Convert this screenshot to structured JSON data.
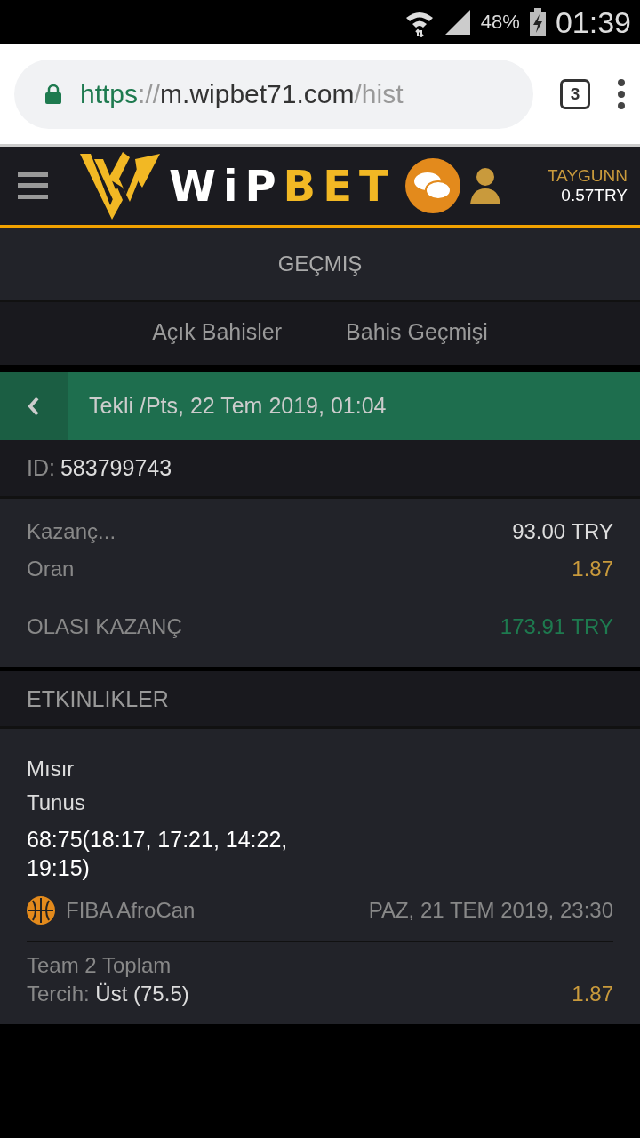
{
  "status_bar": {
    "battery": "48%",
    "time": "01:39"
  },
  "browser": {
    "url": {
      "scheme": "https",
      "sep": "://",
      "host": "m.wipbet71.com",
      "path": "/hist"
    },
    "tab_count": "3"
  },
  "header": {
    "logo": {
      "light": "WiP",
      "accent": "BET"
    },
    "user": {
      "name": "TAYGUNN",
      "balance": "0.57TRY"
    }
  },
  "page_title": "GEÇMIŞ",
  "tabs": [
    {
      "label": "Açık Bahisler",
      "selected": false
    },
    {
      "label": "Bahis Geçmişi",
      "selected": false
    }
  ],
  "bet": {
    "title": "Tekli /Pts, 22 Tem 2019, 01:04",
    "id_label": "ID:",
    "id": "583799743",
    "rows": [
      {
        "label": "Kazanç...",
        "value": "93.00 TRY",
        "kind": "plain"
      },
      {
        "label": "Oran",
        "value": "1.87",
        "kind": "odds"
      }
    ],
    "total": {
      "label": "OLASI KAZANÇ",
      "value": "173.91 TRY"
    }
  },
  "events": {
    "title": "ETKINLIKLER",
    "items": [
      {
        "home": "Mısır",
        "away": "Tunus",
        "score": "68:75(18:17, 17:21, 14:22, 19:15)",
        "league": "FIBA AfroCan",
        "date": "PAZ, 21 TEM 2019, 23:30",
        "market": "Team 2 Toplam",
        "pick_label": "Tercih:",
        "pick": "Üst (75.5)",
        "odds": "1.87"
      }
    ]
  }
}
